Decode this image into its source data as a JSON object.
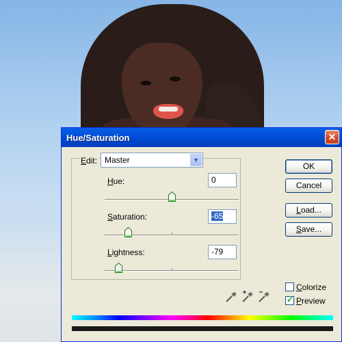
{
  "dialog": {
    "title": "Hue/Saturation",
    "close_glyph": "✕",
    "edit": {
      "label_prefix": "",
      "label_ul": "E",
      "label_rest": "dit:",
      "value": "Master"
    },
    "hue": {
      "label_ul": "H",
      "label_rest": "ue:",
      "value": "0",
      "slider_percent": 50
    },
    "saturation": {
      "label_ul": "S",
      "label_rest": "aturation:",
      "value": "-65",
      "slider_percent": 17.5
    },
    "lightness": {
      "label_ul": "L",
      "label_rest": "ightness:",
      "value": "-79",
      "slider_percent": 10.5
    },
    "buttons": {
      "ok": "OK",
      "cancel": "Cancel",
      "load_ul": "L",
      "load_rest": "oad...",
      "save_ul": "S",
      "save_rest": "ave..."
    },
    "colorize": {
      "label_ul": "C",
      "label_rest": "olorize",
      "checked": false
    },
    "preview": {
      "label_ul": "P",
      "label_rest": "review",
      "checked": true
    },
    "icons": [
      "eyedropper-icon",
      "eyedropper-plus-icon",
      "eyedropper-minus-icon"
    ]
  },
  "colors": {
    "titlebar": "#0048d0",
    "dialog_bg": "#ece9d8",
    "close": "#d6502b"
  }
}
